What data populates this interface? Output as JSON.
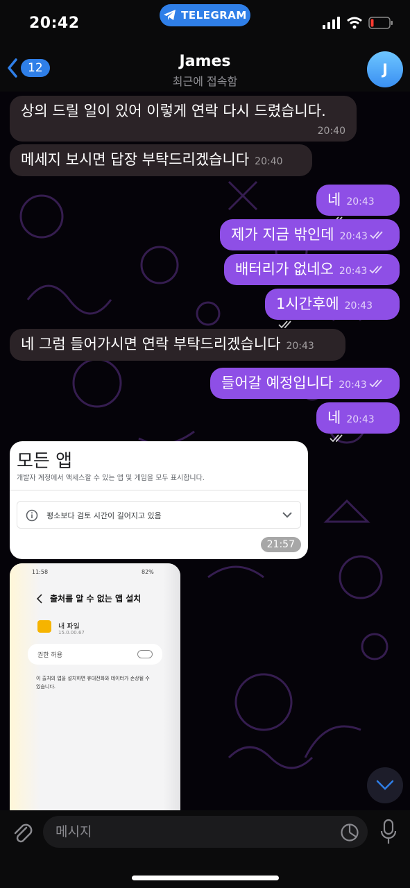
{
  "status_bar": {
    "time": "20:42",
    "app_pill": "TELEGRAM"
  },
  "header": {
    "back_count": "12",
    "name": "James",
    "status": "최근에 접속함",
    "avatar_letter": "J"
  },
  "colors": {
    "accent": "#2f7fe8",
    "outgoing": "#8e4fe6",
    "incoming": "#2b2327"
  },
  "messages": [
    {
      "dir": "in",
      "text": "상의 드릴 일이 있어 이렇게 연락 다시 드렸습니다.",
      "time": "20:40"
    },
    {
      "dir": "in",
      "text": "메세지 보시면 답장 부탁드리겠습니다",
      "time": "20:40"
    },
    {
      "dir": "out",
      "text": "네",
      "time": "20:43"
    },
    {
      "dir": "out",
      "text": "제가 지금 밖인데",
      "time": "20:43"
    },
    {
      "dir": "out",
      "text": "배터리가 없네오",
      "time": "20:43"
    },
    {
      "dir": "out",
      "text": "1시간후에",
      "time": "20:43"
    },
    {
      "dir": "in",
      "text": "네 그럼 들어가시면 연락 부탁드리겠습니다",
      "time": "20:43"
    },
    {
      "dir": "out",
      "text": "들어갈 예정입니다",
      "time": "20:43"
    },
    {
      "dir": "out",
      "text": "네",
      "time": "20:43"
    }
  ],
  "image1": {
    "heading": "모든 앱",
    "desc": "개발자 계정에서 액세스할 수 있는 앱 및 게임을 모두 표시합니다.",
    "notice": "평소보다 검토 시간이 길어지고 있음",
    "time": "21:57"
  },
  "image2": {
    "time": "11:58",
    "battery": "82%",
    "title": "출처를 알 수 없는 앱 설치",
    "app_name": "내 파일",
    "app_version": "15.0.00.67",
    "permission_label": "권한 허용",
    "warning": "이 출처의 앱을 설치하면 휴대전화와 데이터가 손상될 수 있습니다."
  },
  "input": {
    "placeholder": "메시지"
  }
}
